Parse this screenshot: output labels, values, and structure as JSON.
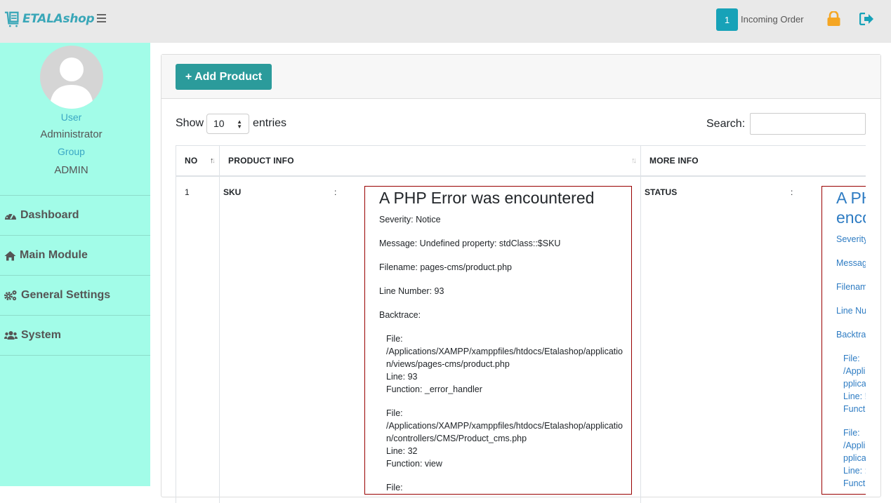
{
  "header": {
    "logo_text": "ETALAshop",
    "incoming_order_count": "1",
    "incoming_order_label": "Incoming Order"
  },
  "sidebar": {
    "user_label": "User",
    "user_role": "Administrator",
    "group_label": "Group",
    "group_value": "ADMIN",
    "items": [
      {
        "label": "Dashboard",
        "icon": "dashboard-icon"
      },
      {
        "label": "Main Module",
        "icon": "home-icon"
      },
      {
        "label": "General Settings",
        "icon": "cogs-icon"
      },
      {
        "label": "System",
        "icon": "users-icon"
      }
    ]
  },
  "main": {
    "add_button_label": "+ Add Product",
    "show_label": "Show",
    "page_length": "10",
    "entries_label": "entries",
    "search_label": "Search:",
    "columns": [
      "NO",
      "PRODUCT INFO",
      "MORE INFO"
    ],
    "rows": [
      {
        "no": "1",
        "product_field": "SKU",
        "product_sep": ":",
        "more_field": "STATUS",
        "more_sep": ":"
      }
    ],
    "error_sku": {
      "title": "A PHP Error was encountered",
      "severity": "Severity: Notice",
      "message": "Message: Undefined property: stdClass::$SKU",
      "filename": "Filename: pages-cms/product.php",
      "line": "Line Number: 93",
      "backtrace": "Backtrace:",
      "frames": [
        {
          "file_label": "File:",
          "path1": "/Applications/XAMPP/xamppfiles/htdocs/Etalashop/applicatio",
          "path2": "n/views/pages-cms/product.php",
          "line": "Line: 93",
          "func": "Function: _error_handler"
        },
        {
          "file_label": "File:",
          "path1": "/Applications/XAMPP/xamppfiles/htdocs/Etalashop/applicatio",
          "path2": "n/controllers/CMS/Product_cms.php",
          "line": "Line: 32",
          "func": "Function: view"
        },
        {
          "file_label": "File:"
        }
      ]
    },
    "error_status": {
      "title1": "A PH",
      "title2": "enco",
      "severity": "Severity",
      "message": "Messag",
      "filename": "Filenam",
      "line": "Line Nu",
      "backtrace": "Backtra",
      "frames": [
        {
          "a": "File:",
          "b": "/Appli",
          "c": "pplica",
          "d": "Line: !",
          "e": "Functi"
        },
        {
          "a": "File:",
          "b": "/Appli",
          "c": "pplica",
          "d": "Line: :",
          "e": "Functi"
        }
      ]
    }
  },
  "colors": {
    "topbar": "#e9e9e9",
    "sidebar": "#a2fce8",
    "accent_teal": "#2b9b9b",
    "badge": "#17a2b8",
    "lock": "#f5a623",
    "error_border": "#990000"
  }
}
